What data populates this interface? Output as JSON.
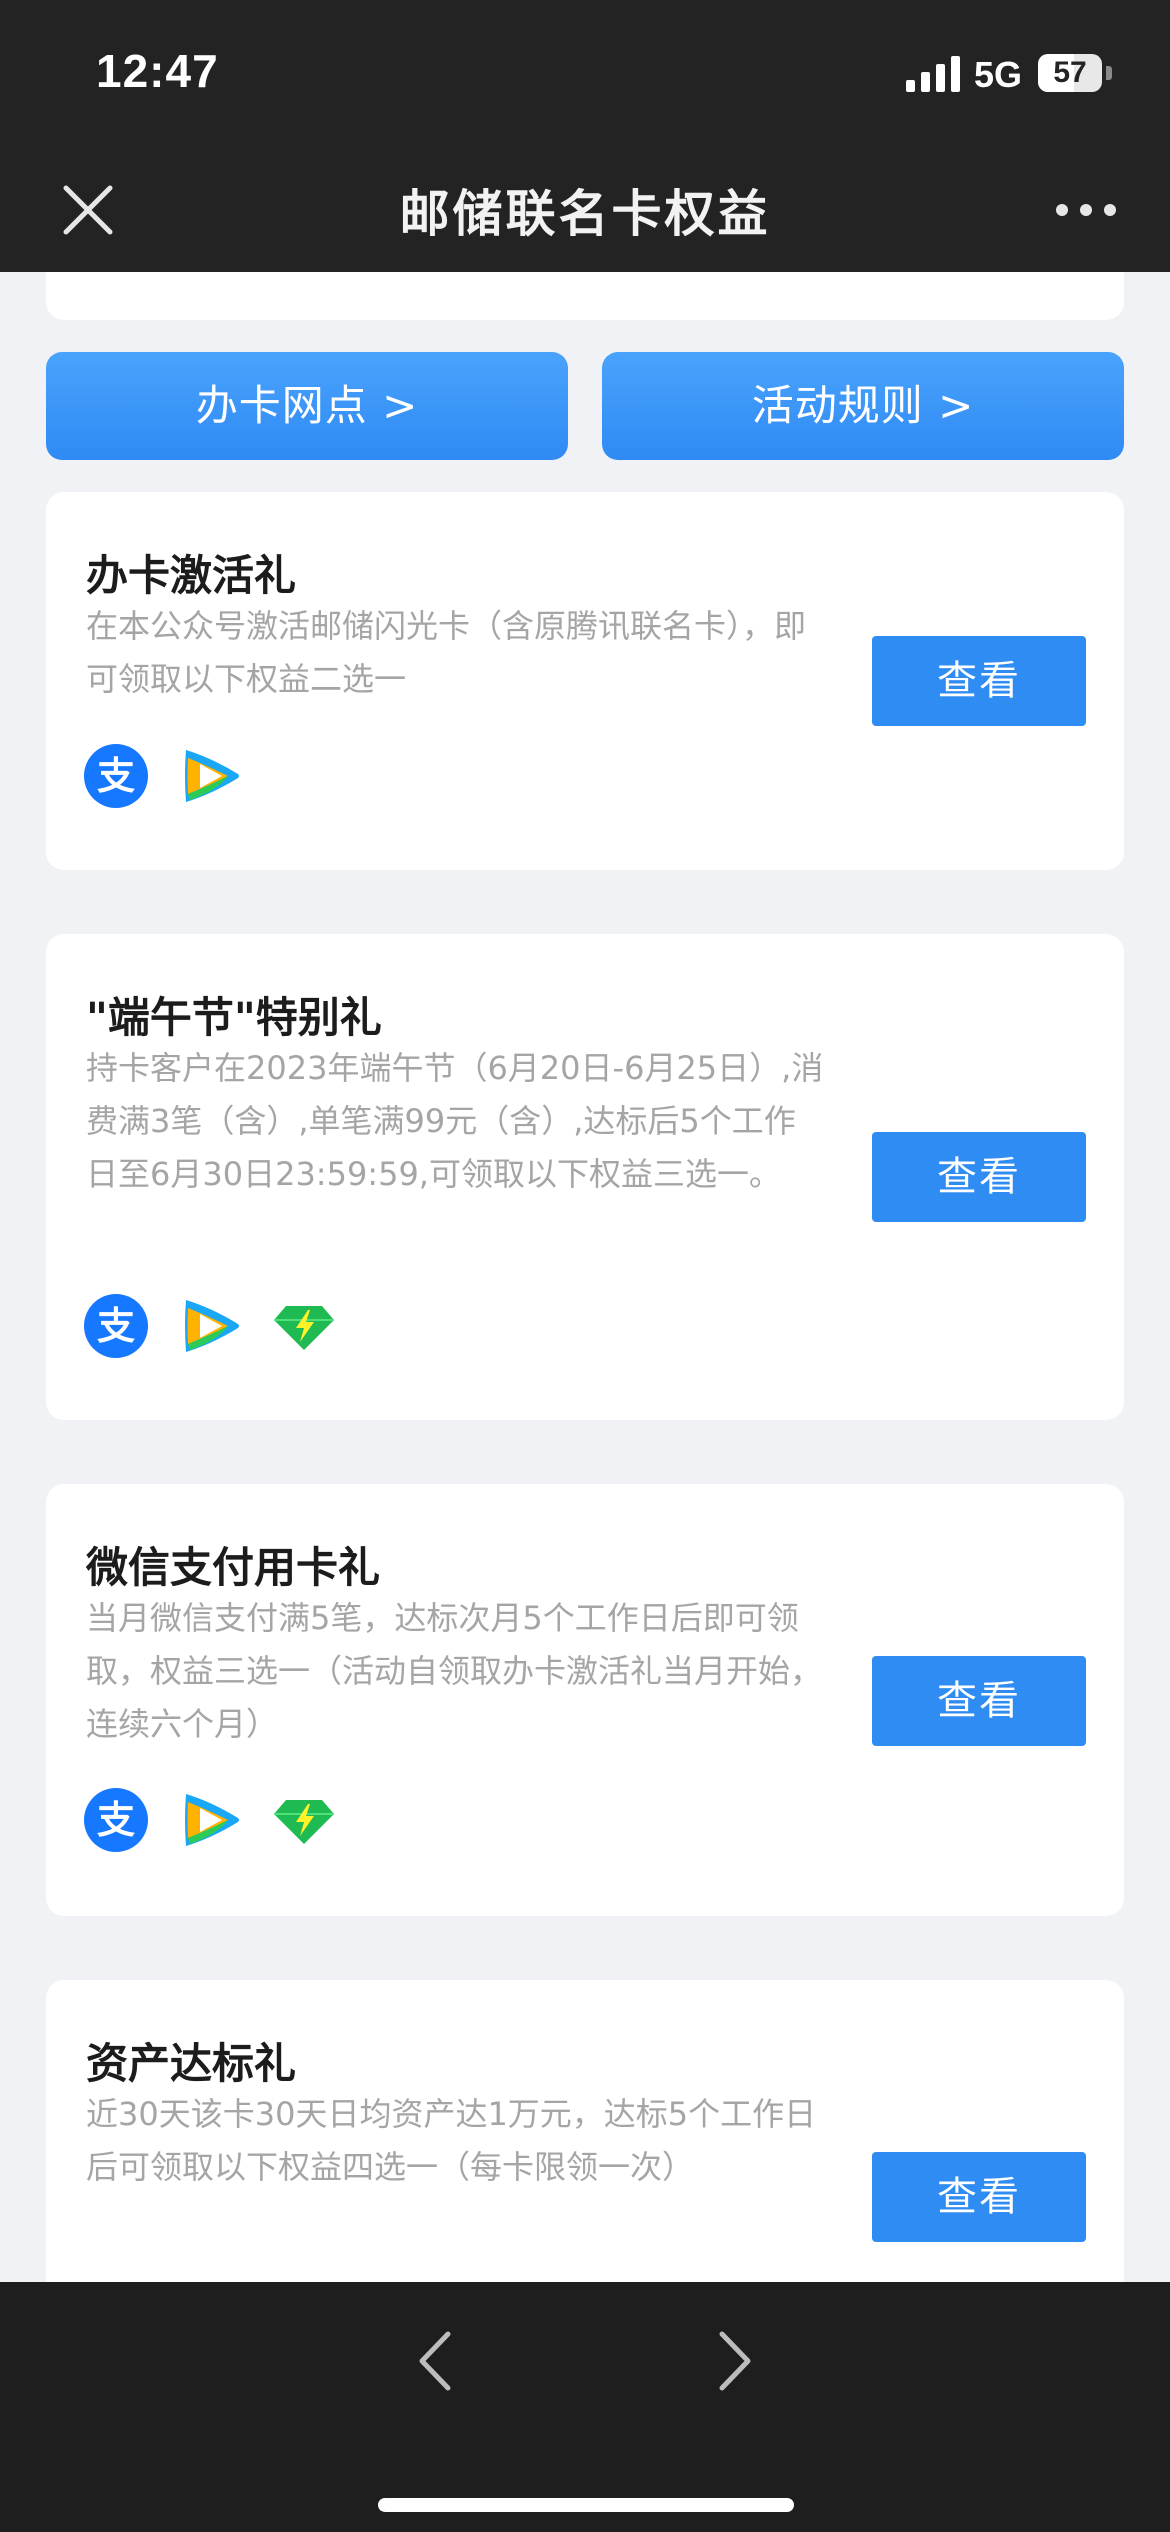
{
  "status_bar": {
    "time": "12:47",
    "network": "5G",
    "battery": "57",
    "battery_level": 0.57
  },
  "nav": {
    "title": "邮储联名卡权益",
    "close_icon": "close-icon",
    "more_icon": "more-icon"
  },
  "links": {
    "branch_label": "办卡网点 >",
    "rules_label": "活动规则 >"
  },
  "cards": [
    {
      "title": "办卡激活礼",
      "description": "在本公众号激活邮储闪光卡（含原腾讯联名卡），即可领取以下权益二选一",
      "button": "查看",
      "icons": [
        "alipay-icon",
        "tencent-video-icon"
      ]
    },
    {
      "title": "\"端午节\"特别礼",
      "description": "持卡客户在2023年端午节（6月20日-6月25日）,消费满3笔（含）,单笔满99元（含）,达标后5个工作日至6月30日23:59:59,可领取以下权益三选一。",
      "button": "查看",
      "icons": [
        "alipay-icon",
        "tencent-video-icon",
        "green-diamond-icon"
      ]
    },
    {
      "title": "微信支付用卡礼",
      "description": "当月微信支付满5笔，达标次月5个工作日后即可领取，权益三选一（活动自领取办卡激活礼当月开始，连续六个月）",
      "button": "查看",
      "icons": [
        "alipay-icon",
        "tencent-video-icon",
        "green-diamond-icon"
      ]
    },
    {
      "title": "资产达标礼",
      "description": "近30天该卡30天日均资产达1万元，达标5个工作日后可领取以下权益四选一（每卡限领一次）",
      "button": "查看",
      "icons": []
    }
  ],
  "colors": {
    "accent_blue": "#2f8cf2",
    "page_bg": "#f1f2f5",
    "bar_dark": "#232323",
    "desc_gray": "#a5a5a5",
    "alipay_blue": "#1677ff",
    "diamond_green": "#1fba52"
  }
}
